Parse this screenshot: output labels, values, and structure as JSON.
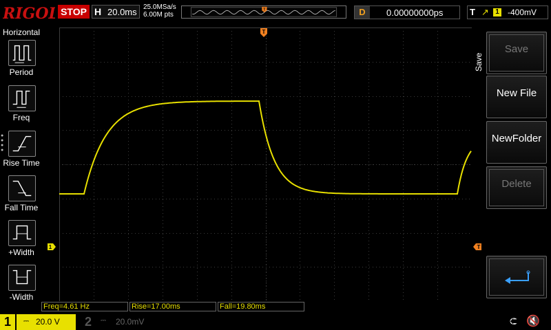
{
  "colors": {
    "trace": "#e8e000",
    "trigger_marker": "#f08020",
    "stop_badge": "#c80000",
    "grid": "#3c3c3c"
  },
  "top_bar": {
    "logo_text": "RIGOL",
    "run_state": "STOP",
    "horizontal_label": "H",
    "timebase": "20.0ms",
    "sample_rate": "25.0MSa/s",
    "memory_depth": "6.00M pts",
    "delay_label": "D",
    "delay_value": "0.00000000ps",
    "trigger_label": "T",
    "trigger_edge_icon": "rising-edge-icon",
    "trigger_source": "1",
    "trigger_level": "-400mV"
  },
  "left_menu": {
    "title": "Horizontal",
    "items": [
      {
        "label": "Period",
        "icon": "period-icon"
      },
      {
        "label": "Freq",
        "icon": "frequency-icon"
      },
      {
        "label": "Rise Time",
        "icon": "rise-time-icon"
      },
      {
        "label": "Fall Time",
        "icon": "fall-time-icon"
      },
      {
        "label": "+Width",
        "icon": "positive-width-icon"
      },
      {
        "label": "-Width",
        "icon": "negative-width-icon"
      }
    ]
  },
  "markers": {
    "ch1_ground": "1",
    "trigger_position": "T",
    "trigger_level": "T"
  },
  "measurements": [
    {
      "label": "Freq=4.61 Hz"
    },
    {
      "label": "Rise=17.00ms"
    },
    {
      "label": "Fall=19.80ms"
    }
  ],
  "channels": {
    "ch1": {
      "number": "1",
      "coupling_icon": "dc-coupling-icon",
      "scale": "20.0 V"
    },
    "ch2": {
      "number": "2",
      "coupling_icon": "dc-coupling-icon",
      "scale": "20.0mV"
    }
  },
  "right_menu": {
    "title": "Save",
    "buttons": [
      {
        "label": "Save",
        "enabled": false
      },
      {
        "label": "New File",
        "enabled": true
      },
      {
        "label": "NewFolder",
        "enabled": true
      },
      {
        "label": "Delete",
        "enabled": false
      },
      {
        "label": "",
        "icon": "return-icon",
        "enabled": true
      }
    ]
  },
  "status_icons": [
    "usb-icon",
    "speaker-muted-icon"
  ]
}
